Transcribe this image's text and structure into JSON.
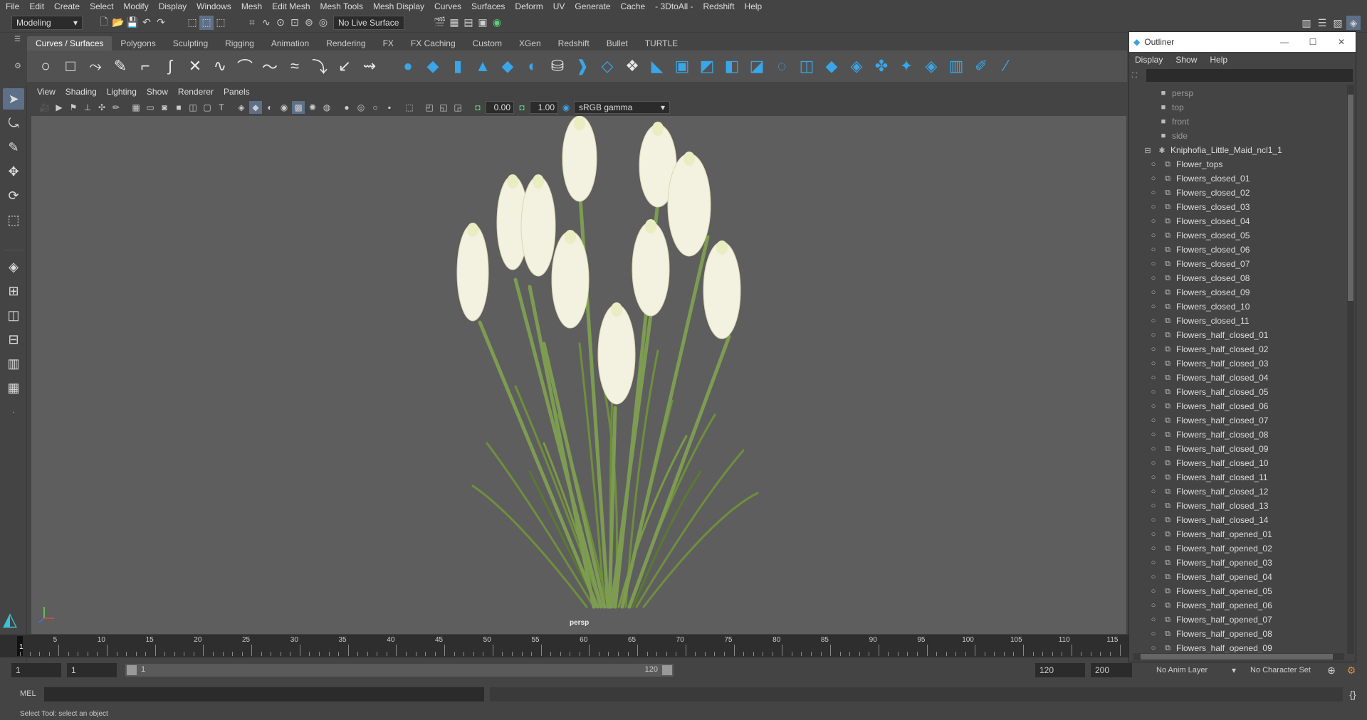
{
  "menubar": [
    "File",
    "Edit",
    "Create",
    "Select",
    "Modify",
    "Display",
    "Windows",
    "Mesh",
    "Edit Mesh",
    "Mesh Tools",
    "Mesh Display",
    "Curves",
    "Surfaces",
    "Deform",
    "UV",
    "Generate",
    "Cache",
    "- 3DtoAll -",
    "Redshift",
    "Help"
  ],
  "status": {
    "workspace": "Modeling",
    "live_surface": "No Live Surface"
  },
  "shelf_tabs": [
    "Curves / Surfaces",
    "Polygons",
    "Sculpting",
    "Rigging",
    "Animation",
    "Rendering",
    "FX",
    "FX Caching",
    "Custom",
    "XGen",
    "Redshift",
    "Bullet",
    "TURTLE"
  ],
  "viewport": {
    "menu": [
      "View",
      "Shading",
      "Lighting",
      "Show",
      "Renderer",
      "Panels"
    ],
    "exposure": "0.00",
    "gamma": "1.00",
    "colorspace": "sRGB gamma",
    "camera_label": "persp"
  },
  "timeline": {
    "ticks": [
      "5",
      "10",
      "15",
      "20",
      "25",
      "30",
      "35",
      "40",
      "45",
      "50",
      "55",
      "60",
      "65",
      "70",
      "75",
      "80",
      "85",
      "90",
      "95",
      "100",
      "105",
      "110",
      "115"
    ],
    "current": "1"
  },
  "range": {
    "start": "1",
    "playback_start": "1",
    "slider_start": "1",
    "slider_end": "120",
    "playback_end": "120",
    "end": "200",
    "anim_layer": "No Anim Layer",
    "char_set": "No Character Set"
  },
  "cmd": {
    "label": "MEL"
  },
  "help_text": "Select Tool: select an object",
  "outliner": {
    "title": "Outliner",
    "menu": [
      "Display",
      "Show",
      "Help"
    ],
    "cameras": [
      "persp",
      "top",
      "front",
      "side"
    ],
    "root": "Kniphofia_Little_Maid_ncl1_1",
    "children": [
      "Flower_tops",
      "Flowers_closed_01",
      "Flowers_closed_02",
      "Flowers_closed_03",
      "Flowers_closed_04",
      "Flowers_closed_05",
      "Flowers_closed_06",
      "Flowers_closed_07",
      "Flowers_closed_08",
      "Flowers_closed_09",
      "Flowers_closed_10",
      "Flowers_closed_11",
      "Flowers_half_closed_01",
      "Flowers_half_closed_02",
      "Flowers_half_closed_03",
      "Flowers_half_closed_04",
      "Flowers_half_closed_05",
      "Flowers_half_closed_06",
      "Flowers_half_closed_07",
      "Flowers_half_closed_08",
      "Flowers_half_closed_09",
      "Flowers_half_closed_10",
      "Flowers_half_closed_11",
      "Flowers_half_closed_12",
      "Flowers_half_closed_13",
      "Flowers_half_closed_14",
      "Flowers_half_opened_01",
      "Flowers_half_opened_02",
      "Flowers_half_opened_03",
      "Flowers_half_opened_04",
      "Flowers_half_opened_05",
      "Flowers_half_opened_06",
      "Flowers_half_opened_07",
      "Flowers_half_opened_08",
      "Flowers_half_opened_09"
    ]
  },
  "colors": {
    "accent": "#5d7087",
    "viewport_bg": "#5e5e5e",
    "shelf_blue": "#39a6e8",
    "flower": "#f3f1df",
    "stem": "#6f8f3c"
  }
}
